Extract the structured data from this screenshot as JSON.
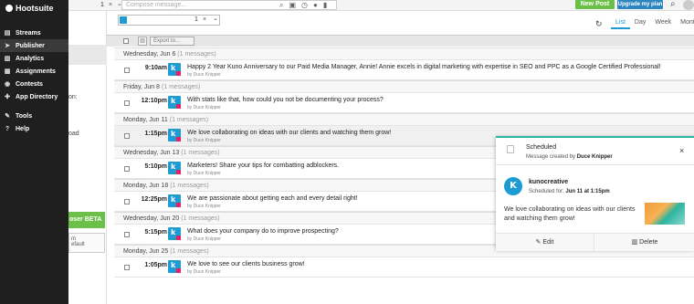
{
  "app": {
    "logo_text": "Hootsuite"
  },
  "topbar": {
    "account_count": "1",
    "compose_placeholder": "Compose message...",
    "new_post_label": "New Post",
    "upgrade_label": "Upgrade my plan",
    "close_glyph": "×",
    "chevron_glyph": "⌄"
  },
  "sidebar": {
    "items": [
      {
        "label": "Streams",
        "icon": "streams-icon"
      },
      {
        "label": "Publisher",
        "icon": "publisher-icon"
      },
      {
        "label": "Analytics",
        "icon": "analytics-icon"
      },
      {
        "label": "Assignments",
        "icon": "assignments-icon"
      },
      {
        "label": "Contests",
        "icon": "contests-icon"
      },
      {
        "label": "App Directory",
        "icon": "app-directory-icon"
      },
      {
        "label": "Tools",
        "icon": "tools-icon"
      },
      {
        "label": "Help",
        "icon": "help-icon"
      }
    ]
  },
  "peek": {
    "fragment_1": "on:",
    "fragment_2": "oad",
    "beta_label": "oser BETA",
    "box_line_1": "m",
    "box_line_2": "efault"
  },
  "filter": {
    "account_count": "1",
    "views": [
      "List",
      "Day",
      "Week",
      "Month"
    ],
    "active_view": "List"
  },
  "actionbar": {
    "export_label": "Export to..."
  },
  "stream": {
    "author_line": "by Duce Knipper",
    "days": [
      {
        "date": "Wednesday, Jun 6",
        "count": "(1 messages)",
        "time": "9:10am",
        "text": "Happy 2 Year Kuno Anniversary to our Paid Media Manager, Annie! Annie excels in digital marketing with expertise in SEO and PPC as a Google Certified Professional!"
      },
      {
        "date": "Friday, Jun 8",
        "count": "(1 messages)",
        "time": "12:10pm",
        "text": "With stats like that, how could you not be documenting your process?"
      },
      {
        "date": "Monday, Jun 11",
        "count": "(1 messages)",
        "time": "1:15pm",
        "text": "We love collaborating on ideas with our clients and watching them grow!"
      },
      {
        "date": "Wednesday, Jun 13",
        "count": "(1 messages)",
        "time": "5:10pm",
        "text": "Marketers! Share your tips for combatting adblockers."
      },
      {
        "date": "Monday, Jun 18",
        "count": "(1 messages)",
        "time": "12:25pm",
        "text": "We are passionate about getting each and every detail right!"
      },
      {
        "date": "Wednesday, Jun 20",
        "count": "(1 messages)",
        "time": "5:15pm",
        "text": "What does your company do to improve prospecting?"
      },
      {
        "date": "Monday, Jun 25",
        "count": "(1 messages)",
        "time": "1:05pm",
        "text": "We love to see our clients business grow!"
      }
    ]
  },
  "popup": {
    "title": "Scheduled",
    "created_prefix": "Message created by ",
    "created_by": "Duce Knipper",
    "brand_name": "kunocreative",
    "scheduled_prefix": "Scheduled for: ",
    "scheduled_when": "Jun 11 at 1:15pm",
    "body": "We love collaborating on ideas with our clients and watching them grow!",
    "edit_label": "Edit",
    "delete_label": "Delete",
    "brand_initial": "K",
    "accent": "#2ab5a0"
  },
  "colors": {
    "sidebar_bg": "#1f1f1f",
    "brand_blue": "#1d9cd3",
    "green": "#6cc04a",
    "upgrade_blue": "#2e86c1"
  }
}
